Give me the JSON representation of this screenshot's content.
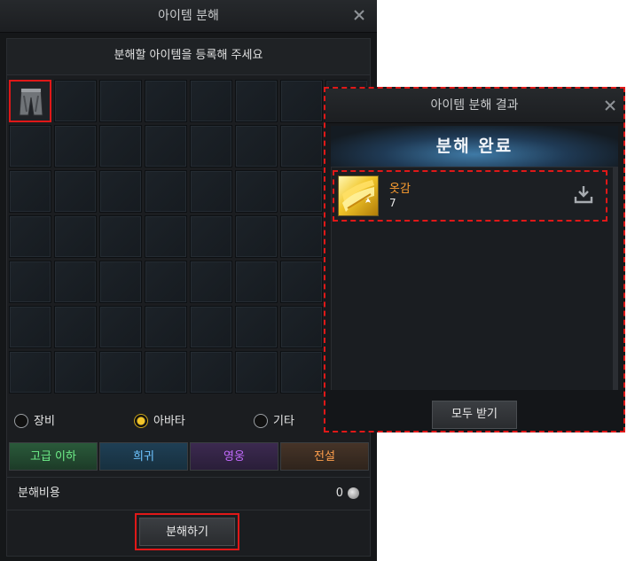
{
  "main_window": {
    "title": "아이템 분해",
    "instruction": "분해할 아이템을 등록해 주세요",
    "registered_item_icon": "pants-icon",
    "radio_options": [
      {
        "label": "장비",
        "selected": false
      },
      {
        "label": "아바타",
        "selected": true
      },
      {
        "label": "기타",
        "selected": false
      }
    ],
    "grade_buttons": [
      {
        "label": "고급 이하",
        "color": "#6ff08a"
      },
      {
        "label": "희귀",
        "color": "#6ec4ff"
      },
      {
        "label": "영웅",
        "color": "#c46bff"
      },
      {
        "label": "전설",
        "color": "#ff9f4c"
      }
    ],
    "cost_label": "분해비용",
    "cost_value": "0",
    "cost_icon": "silver-coin-icon",
    "action_button": "분해하기"
  },
  "result_popup": {
    "title": "아이템 분해 결과",
    "banner": "분해 완료",
    "items": [
      {
        "name": "옷감",
        "quantity": "7",
        "icon": "cloth-material-icon",
        "name_color": "#ff9f30"
      }
    ],
    "receive_all_button": "모두 받기"
  },
  "colors": {
    "highlight": "#e01818",
    "selected_radio": "#f2c52b"
  }
}
